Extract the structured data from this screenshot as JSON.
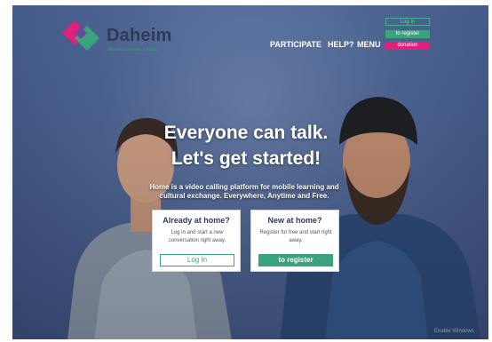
{
  "logo": {
    "name": "Daheim",
    "tagline": "Reden. Lernen. Leben.",
    "colors": [
      "#e2207b",
      "#3aa37d",
      "#6a4a9a"
    ]
  },
  "header": {
    "login_label": "Log In",
    "register_label": "to register",
    "donation_label": "donation",
    "nav": {
      "participate": "PARTICIPATE",
      "help": "HELP?",
      "menu": "MENU"
    }
  },
  "hero": {
    "headline_1": "Everyone can talk.",
    "headline_2": "Let's get started!",
    "subtitle_1": "Home is a video calling platform for mobile learning and",
    "subtitle_2": "cultural exchange. Everywhere, Anytime and Free."
  },
  "cards": {
    "login": {
      "title": "Already at home?",
      "text": "Log in and start a new conversation right away.",
      "button": "Log In"
    },
    "register": {
      "title": "New at home?",
      "text": "Register for free and start right away.",
      "button": "to register"
    }
  },
  "watermark": "Enable Windows",
  "colors": {
    "accent_green": "#3aa37d",
    "accent_pink": "#e2207b",
    "hero_blue": "#4e6593",
    "logo_text": "#2d3a55"
  }
}
